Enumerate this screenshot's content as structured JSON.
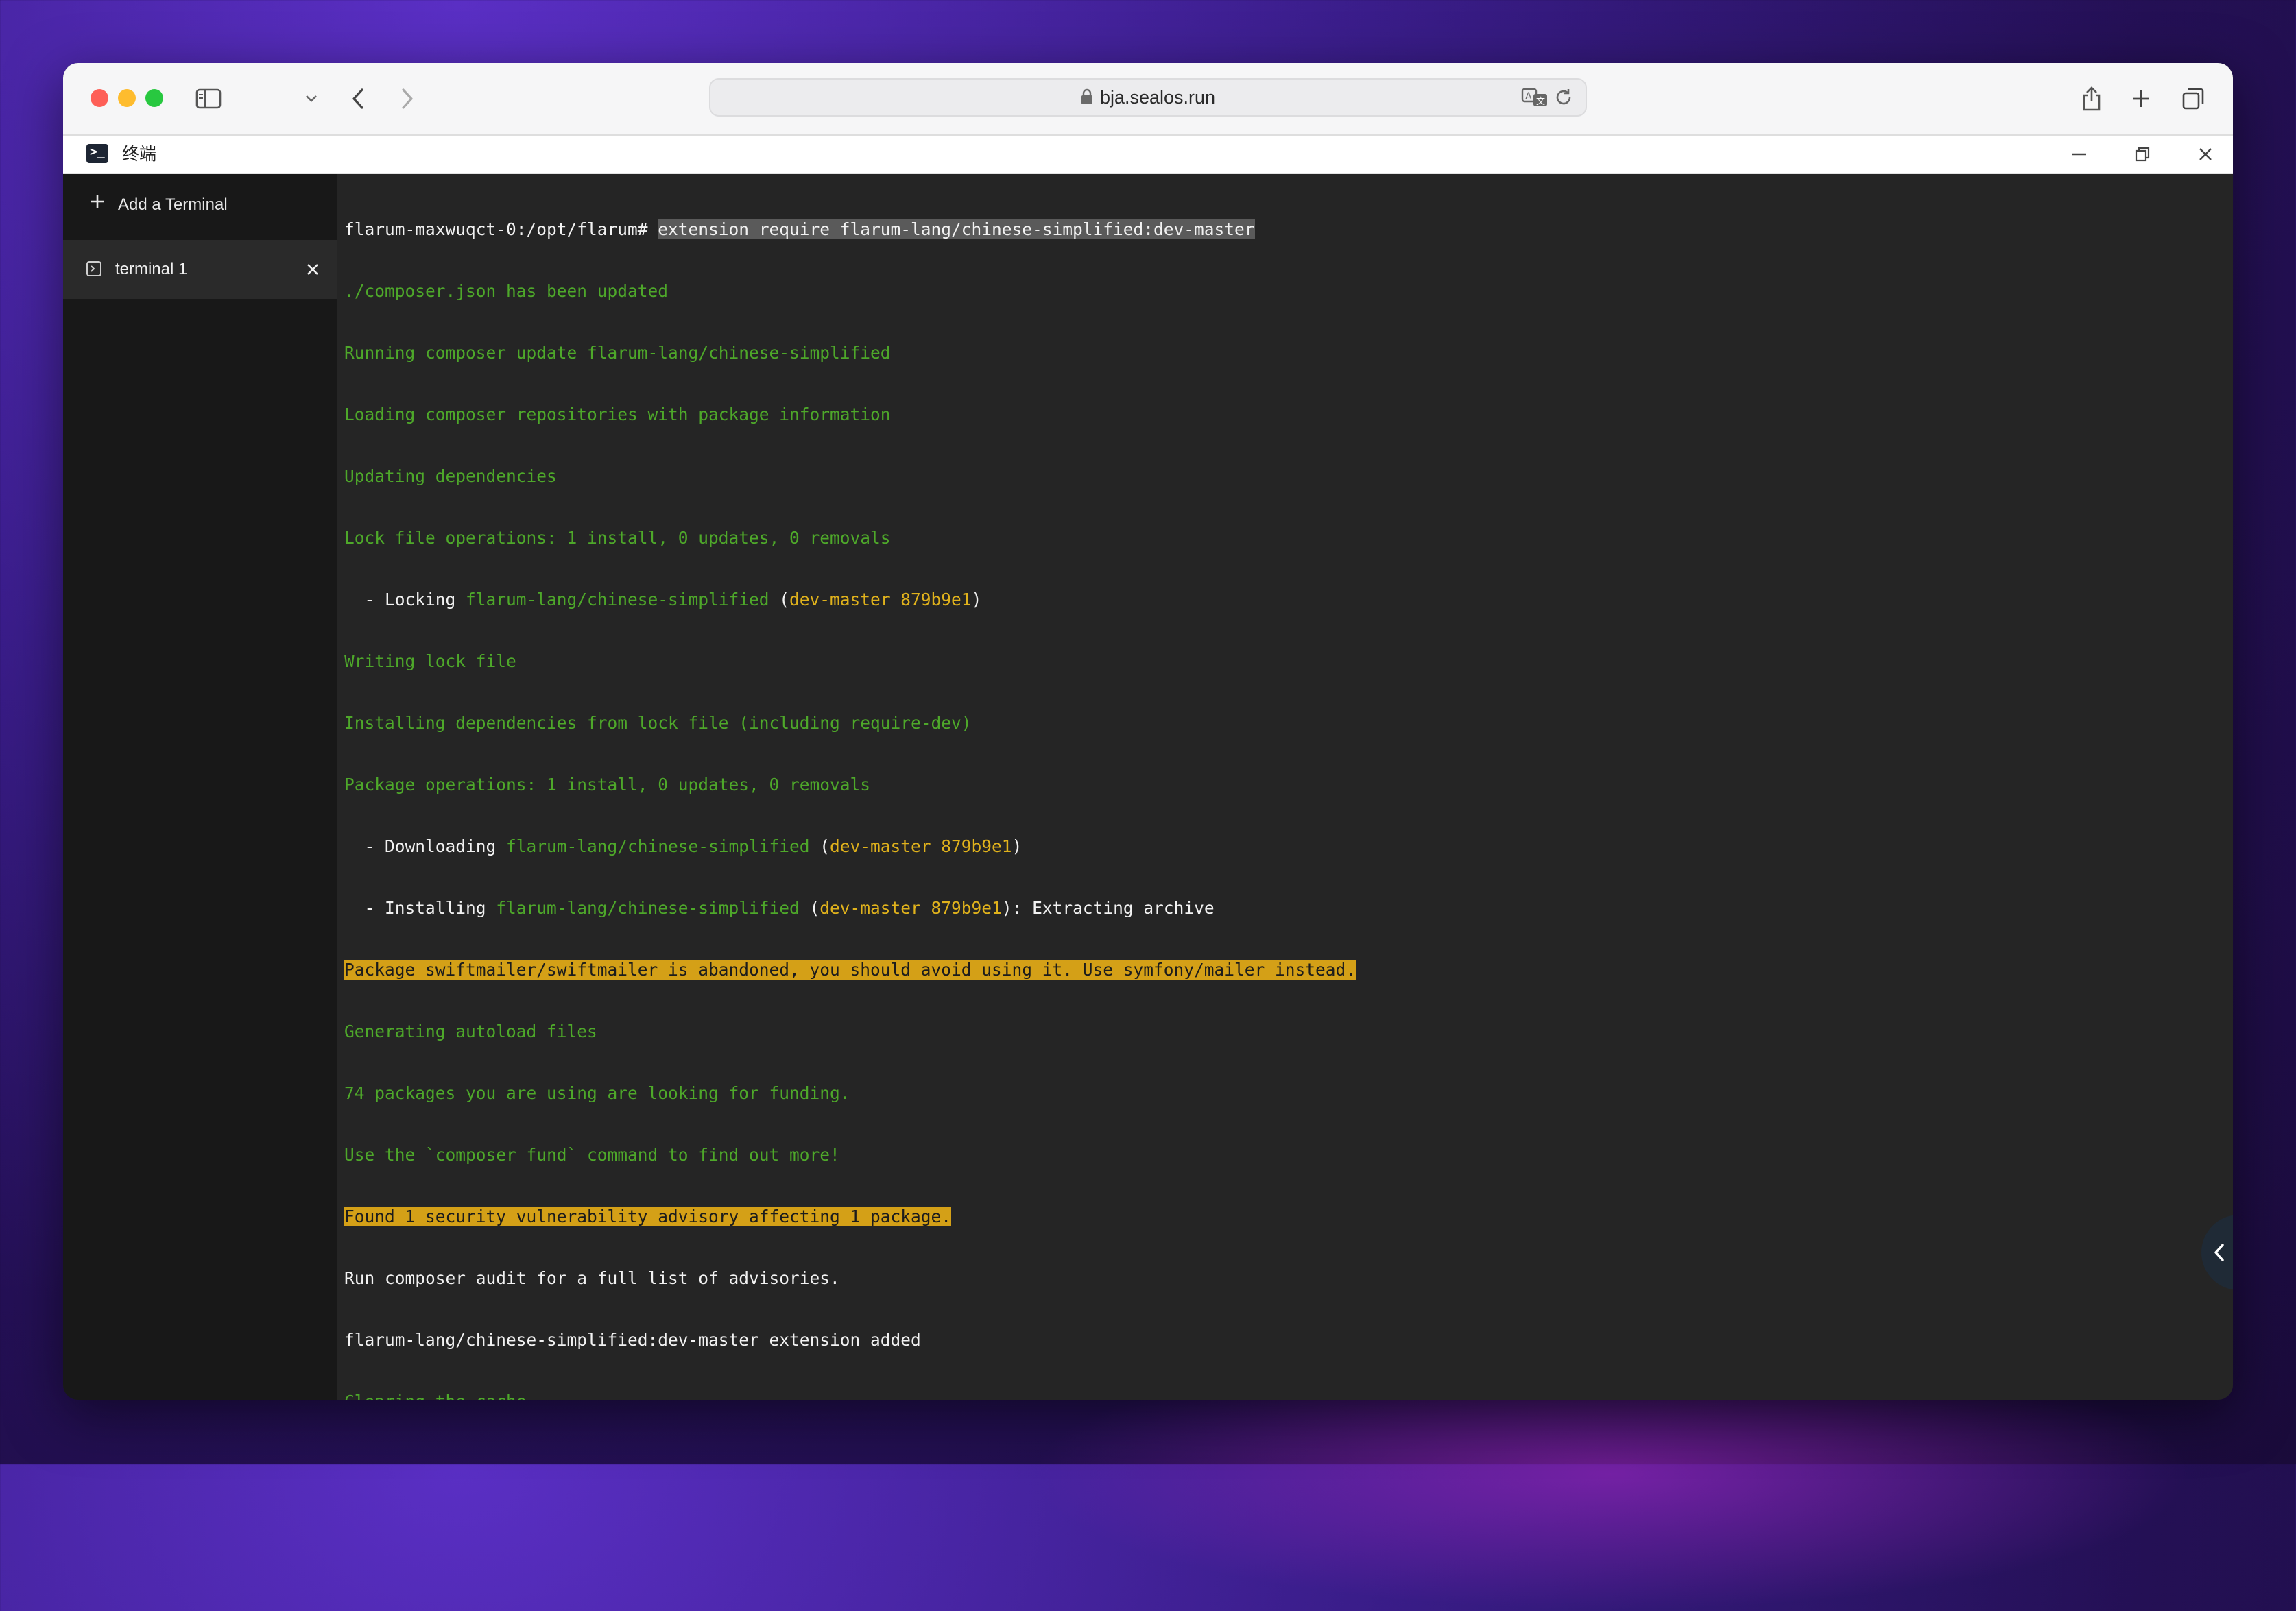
{
  "browser": {
    "url": "bja.sealos.run",
    "icons": [
      "sidebar-icon",
      "chevron-down-icon",
      "back-icon",
      "forward-icon",
      "lock-icon",
      "translate-icon",
      "reload-icon",
      "share-icon",
      "new-tab-icon",
      "tabs-overview-icon"
    ]
  },
  "app": {
    "title": "终端",
    "logo_glyph": ">_",
    "window_controls": [
      "minimize-icon",
      "restore-icon",
      "close-icon"
    ]
  },
  "sidebar": {
    "add_label": "Add a Terminal",
    "terminals": [
      {
        "label": "terminal 1",
        "active": true
      }
    ]
  },
  "terminal": {
    "prompt": "flarum-maxwuqct-0:/opt/flarum# ",
    "command": "extension require flarum-lang/chinese-simplified:dev-master",
    "lines": {
      "l1": "./composer.json has been updated",
      "l2": "Running composer update flarum-lang/chinese-simplified",
      "l3": "Loading composer repositories with package information",
      "l4": "Updating dependencies",
      "l5": "Lock file operations: 1 install, 0 updates, 0 removals",
      "l6a": "  - Locking ",
      "l6b": "flarum-lang/chinese-simplified",
      "l6c": " (",
      "l6d": "dev-master 879b9e1",
      "l6e": ")",
      "l7": "Writing lock file",
      "l8": "Installing dependencies from lock file (including require-dev)",
      "l9": "Package operations: 1 install, 0 updates, 0 removals",
      "l10a": "  - Downloading ",
      "l10b": "flarum-lang/chinese-simplified",
      "l10c": " (",
      "l10d": "dev-master 879b9e1",
      "l10e": ")",
      "l11a": "  - Installing ",
      "l11b": "flarum-lang/chinese-simplified",
      "l11c": " (",
      "l11d": "dev-master 879b9e1",
      "l11e": "): Extracting archive",
      "l12": "Package swiftmailer/swiftmailer is abandoned, you should avoid using it. Use symfony/mailer instead.",
      "l13": "Generating autoload files",
      "l14": "74 packages you are using are looking for funding.",
      "l15": "Use the `composer fund` command to find out more!",
      "l16": "Found 1 security vulnerability advisory affecting 1 package.",
      "l17": "Run composer audit for a full list of advisories.",
      "l18": "flarum-lang/chinese-simplified:dev-master extension added",
      "l19": "Clearing the cache..."
    }
  },
  "colors": {
    "green": "#4ea82a",
    "yellow": "#e0b21c",
    "warning_bg": "#d4a017",
    "terminal_bg": "#252525",
    "sidebar_bg": "#181818"
  }
}
